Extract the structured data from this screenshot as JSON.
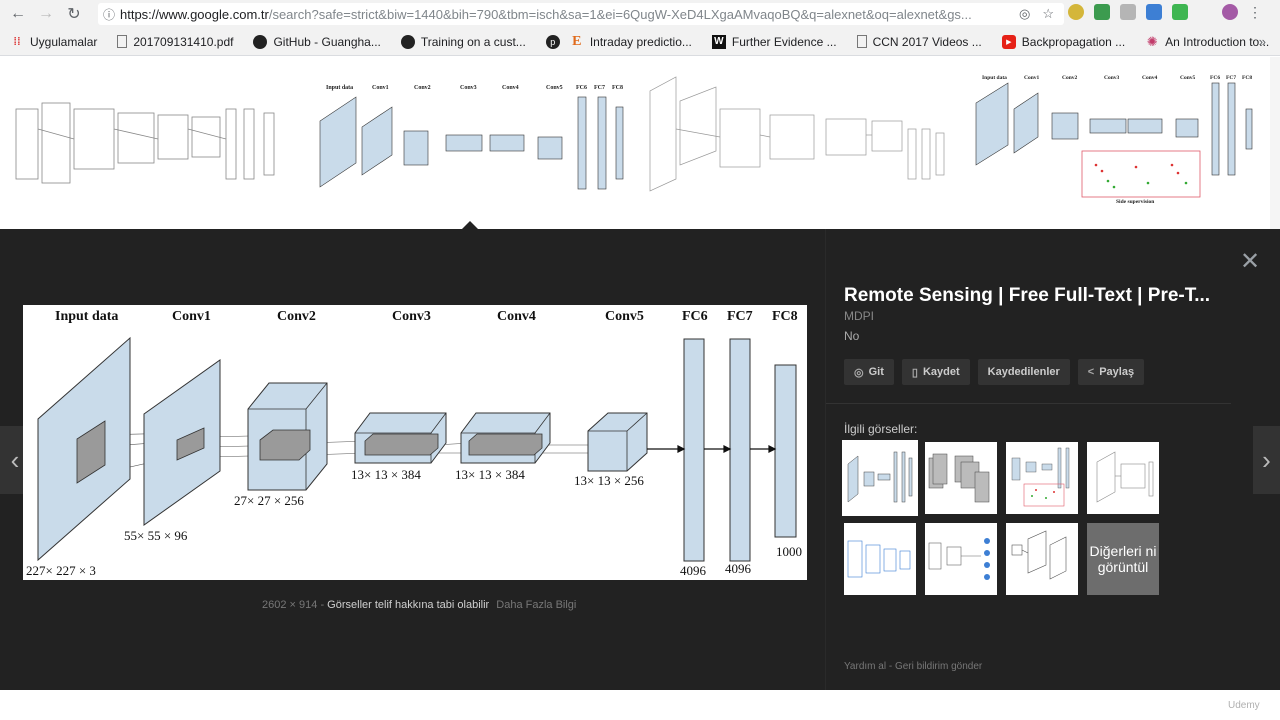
{
  "browser": {
    "url_host": "https://www.google.com.tr",
    "url_path": "/search?safe=strict&biw=1440&bih=790&tbm=isch&sa=1&ei=6QugW-XeD4LXgaAMvaqoBQ&q=alexnet&oq=alexnet&gs...",
    "bookmarks": [
      {
        "label": "Uygulamalar",
        "icon": "apps-grid-icon"
      },
      {
        "label": "201709131410.pdf",
        "icon": "document-icon"
      },
      {
        "label": "GitHub - Guangha...",
        "icon": "github-icon"
      },
      {
        "label": "Training on a cust...",
        "icon": "github-icon"
      },
      {
        "label": "",
        "icon": "pocket-icon"
      },
      {
        "label": "Intraday predictio...",
        "icon": "e-icon"
      },
      {
        "label": "Further Evidence ...",
        "icon": "w-icon"
      },
      {
        "label": "CCN 2017 Videos ...",
        "icon": "document-icon"
      },
      {
        "label": "Backpropagation ...",
        "icon": "youtube-icon"
      },
      {
        "label": "An Introduction to...",
        "icon": "spiral-icon"
      }
    ],
    "more": "»"
  },
  "main_image": {
    "layers": [
      "Input data",
      "Conv1",
      "Conv2",
      "Conv3",
      "Conv4",
      "Conv5",
      "FC6",
      "FC7",
      "FC8"
    ],
    "dims": [
      "227× 227 × 3",
      "55× 55 × 96",
      "27× 27 × 256",
      "13× 13 × 384",
      "13× 13 × 384",
      "13× 13 × 256",
      "4096",
      "4096",
      "1000"
    ]
  },
  "image_meta": {
    "size": "2602 × 914",
    "separator": "-",
    "copyright": "Görseller telif hakkına tabi olabilir",
    "more_info": "Daha Fazla Bilgi"
  },
  "side_panel": {
    "title": "Remote Sensing | Free Full-Text | Pre-T...",
    "source": "MDPI",
    "note": "No",
    "buttons": [
      {
        "label": "Git",
        "icon": "globe-icon",
        "glyph": "◎"
      },
      {
        "label": "Kaydet",
        "icon": "bookmark-icon",
        "glyph": "▯"
      },
      {
        "label": "Kaydedilenler",
        "icon": "",
        "glyph": ""
      },
      {
        "label": "Paylaş",
        "icon": "share-icon",
        "glyph": "<"
      }
    ],
    "related_label": "İlgili görseller:",
    "more_label": "Diğerleri ni görüntül",
    "feedback_help": "Yardım al",
    "feedback_separator": "-",
    "feedback_send": "Geri bildirim gönder"
  },
  "colors": {
    "panel_bg": "#222222",
    "block_fill": "#c9dbea",
    "block_stroke": "#333333"
  },
  "watermark": "Udemy"
}
